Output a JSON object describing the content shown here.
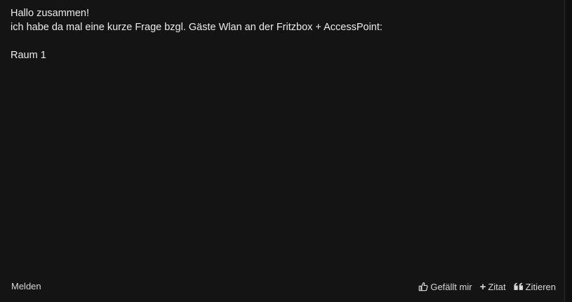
{
  "post": {
    "lines": [
      "Hallo zusammen!",
      "ich habe da mal eine kurze Frage bzgl. Gäste Wlan an der Fritzbox + AccessPoint:",
      "",
      "Raum 1"
    ]
  },
  "footer": {
    "report_label": "Melden",
    "like_label": "Gefällt mir",
    "quote_add_label": "Zitat",
    "reply_quote_label": "Zitieren"
  },
  "icons": {
    "like": "thumbs-up-icon",
    "quote_add": "plus-icon",
    "reply_quote": "quote-icon"
  }
}
